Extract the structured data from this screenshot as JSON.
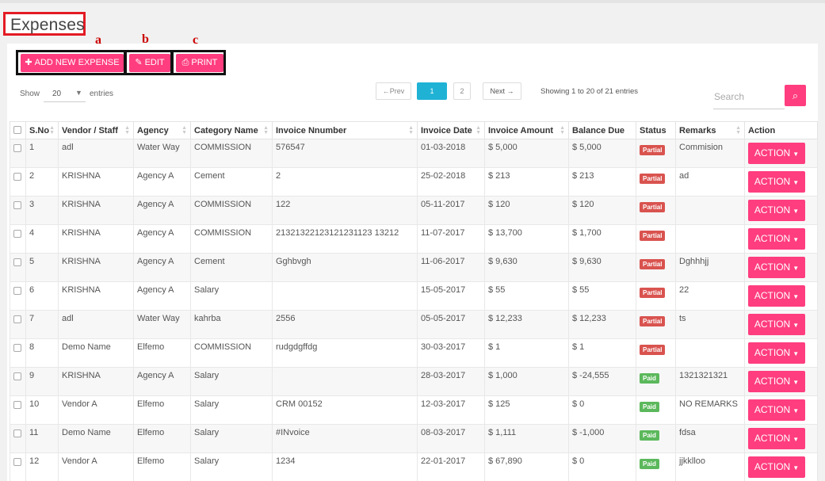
{
  "page": {
    "title": "Expenses"
  },
  "annotations": {
    "a": "a",
    "b": "b",
    "c": "c"
  },
  "toolbar": {
    "add_label": "ADD NEW EXPENSE",
    "edit_label": "EDIT",
    "print_label": "PRINT"
  },
  "length": {
    "show": "Show",
    "value": "20",
    "entries": "entries"
  },
  "pagination": {
    "prev": "←Prev",
    "pages": [
      "1",
      "2"
    ],
    "next": "Next →",
    "active_page": "1"
  },
  "info": "Showing 1 to 20 of 21 entries",
  "search": {
    "placeholder": "Search"
  },
  "table": {
    "headers": [
      "S.No",
      "Vendor / Staff",
      "Agency",
      "Category Name",
      "Invoice Nnumber",
      "Invoice Date",
      "Invoice Amount",
      "Balance Due",
      "Status",
      "Remarks",
      "Action"
    ],
    "action_label": "ACTION",
    "rows": [
      [
        "1",
        "adl",
        "Water Way",
        "COMMISSION",
        "576547",
        "01-03-2018",
        "$ 5,000",
        "$ 5,000",
        "Partial",
        "Commision"
      ],
      [
        "2",
        "KRISHNA",
        "Agency A",
        "Cement",
        "2",
        "25-02-2018",
        "$ 213",
        "$ 213",
        "Partial",
        "ad"
      ],
      [
        "3",
        "KRISHNA",
        "Agency A",
        "COMMISSION",
        "122",
        "05-11-2017",
        "$ 120",
        "$ 120",
        "Partial",
        ""
      ],
      [
        "4",
        "KRISHNA",
        "Agency A",
        "COMMISSION",
        "21321322123121231123 13212",
        "11-07-2017",
        "$ 13,700",
        "$ 1,700",
        "Partial",
        ""
      ],
      [
        "5",
        "KRISHNA",
        "Agency A",
        "Cement",
        "Gghbvgh",
        "11-06-2017",
        "$ 9,630",
        "$ 9,630",
        "Partial",
        "Dghhhjj"
      ],
      [
        "6",
        "KRISHNA",
        "Agency A",
        "Salary",
        "",
        "15-05-2017",
        "$ 55",
        "$ 55",
        "Partial",
        "22"
      ],
      [
        "7",
        "adl",
        "Water Way",
        "kahrba",
        "2556",
        "05-05-2017",
        "$ 12,233",
        "$ 12,233",
        "Partial",
        "ts"
      ],
      [
        "8",
        "Demo Name",
        "Elfemo",
        "COMMISSION",
        "rudgdgffdg",
        "30-03-2017",
        "$ 1",
        "$ 1",
        "Partial",
        ""
      ],
      [
        "9",
        "KRISHNA",
        "Agency A",
        "Salary",
        "",
        "28-03-2017",
        "$ 1,000",
        "$ -24,555",
        "Paid",
        "1321321321"
      ],
      [
        "10",
        "Vendor A",
        "Elfemo",
        "Salary",
        "CRM 00152",
        "12-03-2017",
        "$ 125",
        "$ 0",
        "Paid",
        "NO REMARKS"
      ],
      [
        "11",
        "Demo Name",
        "Elfemo",
        "Salary",
        "#INvoice",
        "08-03-2017",
        "$ 1,111",
        "$ -1,000",
        "Paid",
        "fdsa"
      ],
      [
        "12",
        "Vendor A",
        "Elfemo",
        "Salary",
        "1234",
        "22-01-2017",
        "$ 67,890",
        "$ 0",
        "Paid",
        "jjkklloo"
      ]
    ]
  },
  "colors": {
    "accent": "#ff3d7f",
    "active_page": "#1fb2d5",
    "partial": "#d9534f",
    "paid": "#5cb85c",
    "annotation": "#e31b23"
  },
  "icons": {
    "add": "plus-icon",
    "edit": "edit-icon",
    "print": "print-icon",
    "search": "search-icon",
    "sort": "sort-icon",
    "dropdown": "caret-down-icon"
  }
}
